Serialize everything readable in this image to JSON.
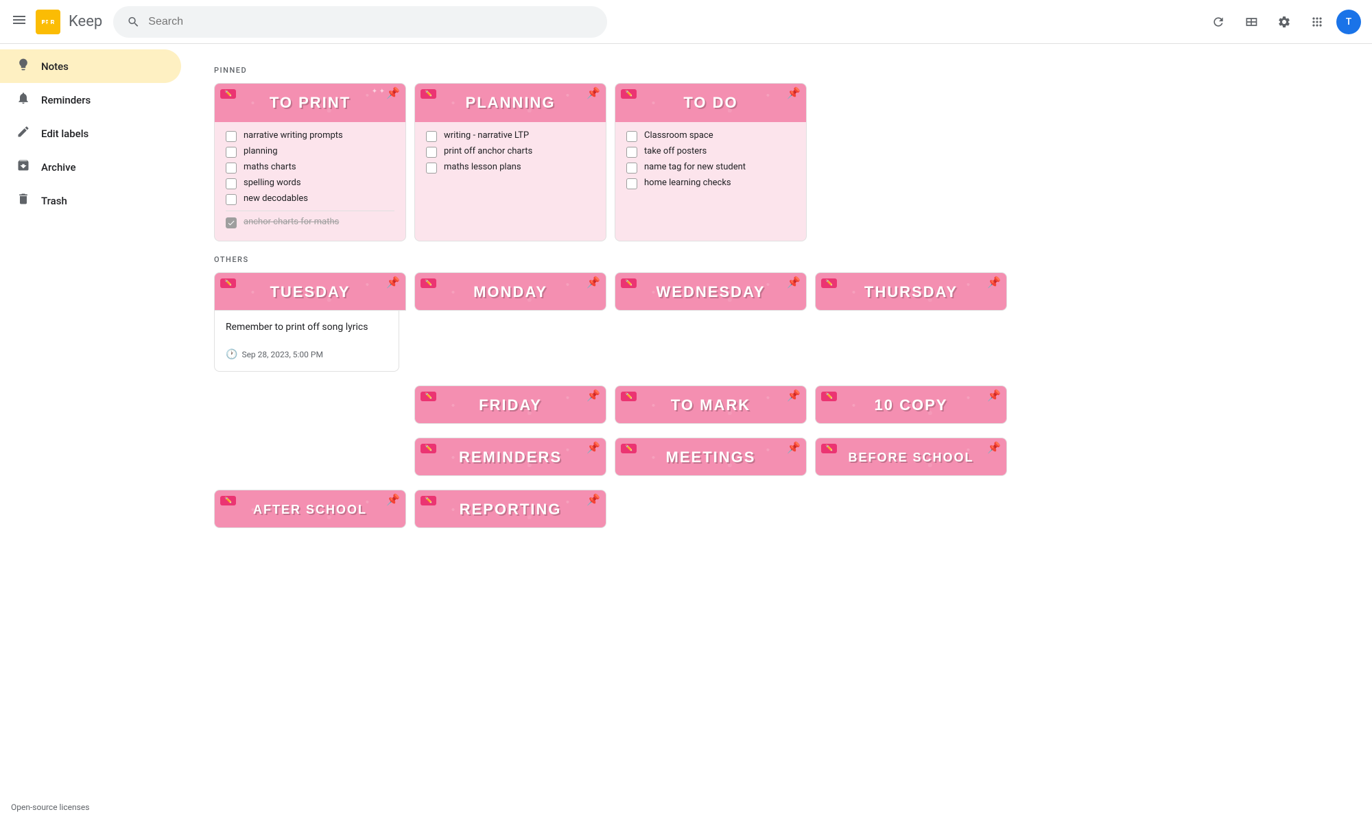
{
  "app": {
    "name": "Keep",
    "search_placeholder": "Search"
  },
  "sidebar": {
    "items": [
      {
        "id": "notes",
        "label": "Notes",
        "icon": "💡",
        "active": true
      },
      {
        "id": "reminders",
        "label": "Reminders",
        "icon": "🔔",
        "active": false
      },
      {
        "id": "edit-labels",
        "label": "Edit labels",
        "icon": "✏️",
        "active": false
      },
      {
        "id": "archive",
        "label": "Archive",
        "icon": "📦",
        "active": false
      },
      {
        "id": "trash",
        "label": "Trash",
        "icon": "🗑️",
        "active": false
      }
    ],
    "bottom_link": "Open-source licenses"
  },
  "sections": {
    "pinned_label": "PINNED",
    "others_label": "OTHERS"
  },
  "pinned_notes": [
    {
      "id": "to-print",
      "banner": "TO PRINT",
      "items": [
        {
          "text": "narrative writing prompts",
          "checked": false
        },
        {
          "text": "planning",
          "checked": false
        },
        {
          "text": "maths charts",
          "checked": false
        },
        {
          "text": "spelling words",
          "checked": false
        },
        {
          "text": "new decodables",
          "checked": false
        },
        {
          "text": "anchor charts for maths",
          "checked": true
        }
      ]
    },
    {
      "id": "planning",
      "banner": "PLANNING",
      "items": [
        {
          "text": "writing - narrative LTP",
          "checked": false
        },
        {
          "text": "print off anchor charts",
          "checked": false
        },
        {
          "text": "maths lesson plans",
          "checked": false
        }
      ]
    },
    {
      "id": "to-do",
      "banner": "TO DO",
      "items": [
        {
          "text": "Classroom space",
          "checked": false
        },
        {
          "text": "take off posters",
          "checked": false
        },
        {
          "text": "name tag for new student",
          "checked": false
        },
        {
          "text": "home learning checks",
          "checked": false
        }
      ]
    }
  ],
  "others_notes": [
    {
      "id": "tuesday",
      "banner": "TUESDAY"
    },
    {
      "id": "monday",
      "banner": "MONDAY"
    },
    {
      "id": "wednesday",
      "banner": "WEDNESDAY"
    },
    {
      "id": "thursday",
      "banner": "THURSDAY"
    },
    {
      "id": "tuesday-reminder",
      "type": "reminder",
      "text": "Remember to print off song lyrics",
      "time": "Sep 28, 2023, 5:00 PM"
    },
    {
      "id": "friday",
      "banner": "FRIDAY"
    },
    {
      "id": "to-mark",
      "banner": "TO MARK"
    },
    {
      "id": "to-copy",
      "banner": "10 COPY"
    },
    {
      "id": "reminders-note",
      "banner": "REMINDERS"
    },
    {
      "id": "meetings",
      "banner": "MEETINGS"
    },
    {
      "id": "before-school",
      "banner": "BEFORE SCHOOL"
    },
    {
      "id": "after-school",
      "banner": "AFTER SCHOOL"
    },
    {
      "id": "reporting",
      "banner": "REPORTING"
    }
  ]
}
